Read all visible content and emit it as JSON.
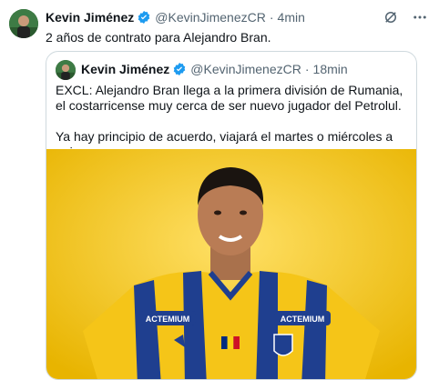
{
  "tweet": {
    "author_name": "Kevin Jiménez",
    "handle": "@KevinJimenezCR",
    "separator": "·",
    "time": "4min",
    "text": "2 años de contrato para Alejandro Bran."
  },
  "quoted": {
    "author_name": "Kevin Jiménez",
    "handle": "@KevinJimenezCR",
    "separator": "·",
    "time": "18min",
    "paragraph1": "EXCL: Alejandro Bran llega a la primera división de Rumania, el costarricense muy cerca de ser nuevo jugador del Petrolul.",
    "paragraph2": "Ya hay principio de acuerdo, viajará el martes o miércoles a unirse.",
    "image": {
      "sponsor_text_left": "ACTEMIUM",
      "sponsor_text_right": "ACTEMIUM"
    }
  },
  "colors": {
    "verified": "#1d9bf0",
    "muted": "#536471",
    "photo_bg": "#f2c62a",
    "jersey_yellow": "#f5c518",
    "jersey_blue": "#1f3f8f"
  },
  "icons": [
    "verified-badge-icon",
    "grok-icon",
    "more-icon"
  ]
}
